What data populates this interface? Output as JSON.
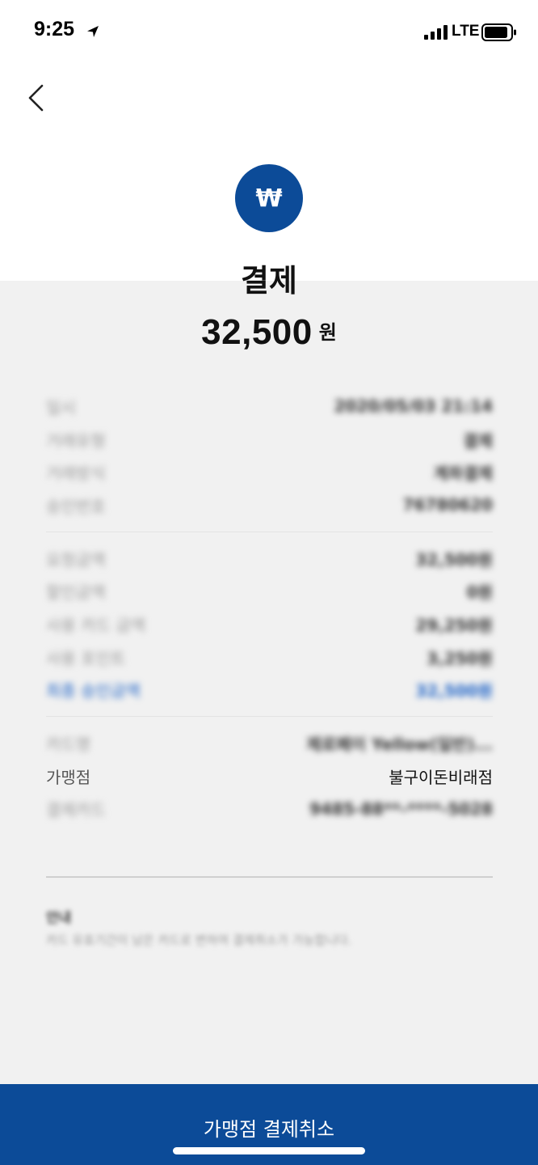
{
  "status_bar": {
    "time": "9:25",
    "network": "LTE"
  },
  "header": {
    "currency_symbol": "₩",
    "title": "결제",
    "amount": "32,500",
    "amount_unit": "원"
  },
  "details": {
    "group1": [
      {
        "label": "일시",
        "value": "2020/05/03 21:14"
      },
      {
        "label": "거래유형",
        "value": "결제"
      },
      {
        "label": "거래방식",
        "value": "계좌결제"
      },
      {
        "label": "승인번호",
        "value": "76780620"
      }
    ],
    "group2": [
      {
        "label": "요청금액",
        "value": "32,500원"
      },
      {
        "label": "할인금액",
        "value": "0원"
      },
      {
        "label": "사용 카드 금액",
        "value": "29,250원"
      },
      {
        "label": "사용 포인트",
        "value": "3,250원"
      },
      {
        "label": "최종 승인금액",
        "value": "32,500원"
      }
    ],
    "group3": [
      {
        "label": "카드명",
        "value": "제로페이 Yellow(일반)..."
      },
      {
        "label": "가맹점",
        "value": "불구이돈비래점"
      },
      {
        "label": "결제카드",
        "value": "9485-88**-****-5028"
      }
    ]
  },
  "notice": {
    "title": "안내",
    "text": "카드 유효기간이 남은 카드로 변하여 결제취소가 가능합니다."
  },
  "bottom_button": {
    "label": "가맹점 결제취소"
  },
  "colors": {
    "brand_blue": "#0c4b98",
    "link_blue": "#1e63c6"
  }
}
